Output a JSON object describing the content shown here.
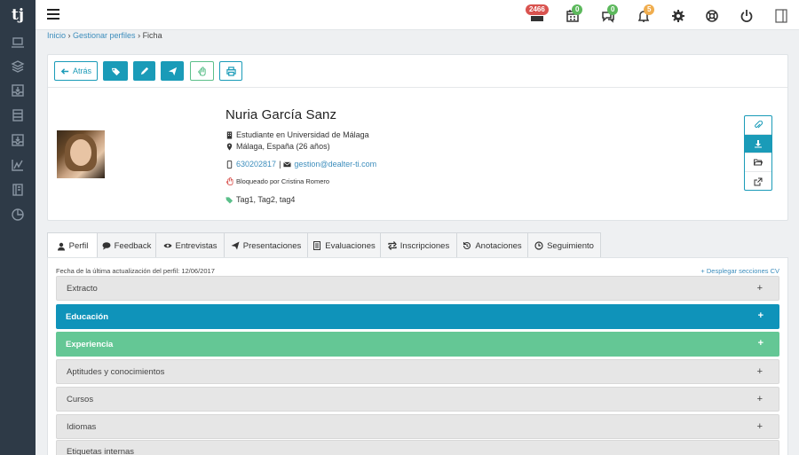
{
  "sidebar": {
    "logo": "tj",
    "icons": [
      "laptop-icon",
      "layers-icon",
      "inbox-icon",
      "database-icon",
      "inbox-down-icon",
      "chart-icon",
      "book-icon",
      "pie-chart-icon"
    ]
  },
  "topbar": {
    "badges": {
      "messages": "2466",
      "calendar": "0",
      "chat": "0",
      "notifications": "5"
    },
    "colors": {
      "red": "#d9534f",
      "green": "#5cb85c",
      "orange": "#f0ad4e"
    }
  },
  "breadcrumb": {
    "home": "Inicio",
    "sep1": " › ",
    "profiles": "Gestionar perfiles",
    "sep2": " › ",
    "current": "Ficha"
  },
  "toolbar": {
    "back_label": "Atrás"
  },
  "profile": {
    "name": "Nuria García Sanz",
    "occupation": "Estudiante en Universidad de Málaga",
    "location": "Málaga, España (26 años)",
    "phone": "630202817",
    "separator": "|",
    "email": "gestion@dealter-ti.com",
    "blocked": "Bloqueado por Cristina Romero",
    "tags": "Tag1, Tag2, tag4"
  },
  "tabs": [
    {
      "label": "Perfil",
      "icon": "user-icon"
    },
    {
      "label": "Feedback",
      "icon": "chat-icon"
    },
    {
      "label": "Entrevistas",
      "icon": "eye-icon"
    },
    {
      "label": "Presentaciones",
      "icon": "send-icon"
    },
    {
      "label": "Evaluaciones",
      "icon": "document-icon"
    },
    {
      "label": "Inscripciones",
      "icon": "retweet-icon"
    },
    {
      "label": "Anotaciones",
      "icon": "history-icon"
    },
    {
      "label": "Seguimiento",
      "icon": "clock-icon"
    }
  ],
  "cv": {
    "updated": "Fecha de la última actualización del perfil: 12/06/2017",
    "expand_all": "+ Desplegar secciones CV",
    "sections": [
      {
        "label": "Extracto",
        "style": "grey",
        "sign": "+"
      },
      {
        "label": "Educación",
        "style": "blue",
        "sign": "+"
      },
      {
        "label": "Experiencia",
        "style": "green",
        "sign": "+"
      },
      {
        "label": "Aptitudes y conocimientos",
        "style": "grey",
        "sign": "+"
      },
      {
        "label": "Cursos",
        "style": "grey",
        "sign": "+"
      },
      {
        "label": "Idiomas",
        "style": "grey",
        "sign": "+"
      },
      {
        "label": "Etiquetas internas",
        "style": "grey",
        "sign": "+"
      }
    ]
  },
  "colors": {
    "accent": "#1a9bb8",
    "sidebar": "#2e3a47",
    "blue_section": "#0f93ba",
    "green_section": "#64c795"
  }
}
